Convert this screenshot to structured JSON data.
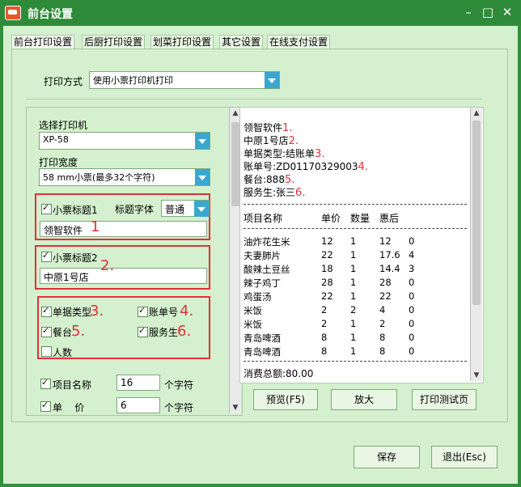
{
  "window": {
    "title": "前台设置",
    "min": "–",
    "max": "□",
    "close": "✕"
  },
  "tabs": [
    "前台打印设置",
    "后厨打印设置",
    "划菜打印设置",
    "其它设置",
    "在线支付设置"
  ],
  "print_mode": {
    "label": "打印方式",
    "value": "使用小票打印机打印"
  },
  "printer": {
    "label": "选择打印机",
    "value": "XP-58"
  },
  "print_width": {
    "label": "打印宽度",
    "value": "58 mm小票(最多32个字符)"
  },
  "ticket_title1": {
    "label": "小票标题1",
    "checked": true,
    "font_label": "标题字体",
    "font_value": "普通",
    "text": "领智软件",
    "num": "1"
  },
  "ticket_title2": {
    "label": "小票标题2",
    "checked": true,
    "text": "中原1号店",
    "num": "2."
  },
  "options": [
    {
      "label": "单据类型",
      "num": "3.",
      "checked": true
    },
    {
      "label": "账单号",
      "num": "4.",
      "checked": true
    },
    {
      "label": "餐台",
      "num": "5.",
      "checked": true
    },
    {
      "label": "服务生",
      "num": "6.",
      "checked": true
    },
    {
      "label": "人数",
      "num": "",
      "checked": false
    }
  ],
  "fields": [
    {
      "label": "项目名称",
      "value": "16",
      "unit": "个字符",
      "checked": true
    },
    {
      "label": "单    价",
      "value": "6",
      "unit": "个字符",
      "checked": true
    }
  ],
  "preview": {
    "header_lines": [
      {
        "text": "领智软件",
        "num": "1."
      },
      {
        "text": "中原1号店",
        "num": "2."
      },
      {
        "text": "单据类型:结账单",
        "num": "3."
      },
      {
        "text": "账单号:ZD01170329003",
        "num": "4."
      },
      {
        "text": "餐台:888",
        "num": "5."
      },
      {
        "text": "服务生:张三",
        "num": "6."
      }
    ],
    "columns": [
      "项目名称",
      "单价",
      "数量",
      "惠后"
    ],
    "rows": [
      [
        "油炸花生米",
        "12",
        "1",
        "12",
        "0"
      ],
      [
        "夫妻肺片",
        "22",
        "1",
        "17.6",
        "4"
      ],
      [
        "酸辣土豆丝",
        "18",
        "1",
        "14.4",
        "3"
      ],
      [
        "辣子鸡丁",
        "28",
        "1",
        "28",
        "0"
      ],
      [
        "鸡蛋汤",
        "22",
        "1",
        "22",
        "0"
      ],
      [
        "米饭",
        "2",
        "2",
        "4",
        "0"
      ],
      [
        "米饭",
        "2",
        "1",
        "2",
        "0"
      ],
      [
        "青岛啤酒",
        "8",
        "1",
        "8",
        "0"
      ],
      [
        "青岛啤酒",
        "8",
        "1",
        "8",
        "0"
      ]
    ],
    "total": "消费总额:80.00"
  },
  "buttons": {
    "preview": "预览(F5)",
    "zoom": "放大",
    "print_test": "打印测试页",
    "save": "保存",
    "exit": "退出(Esc)"
  }
}
